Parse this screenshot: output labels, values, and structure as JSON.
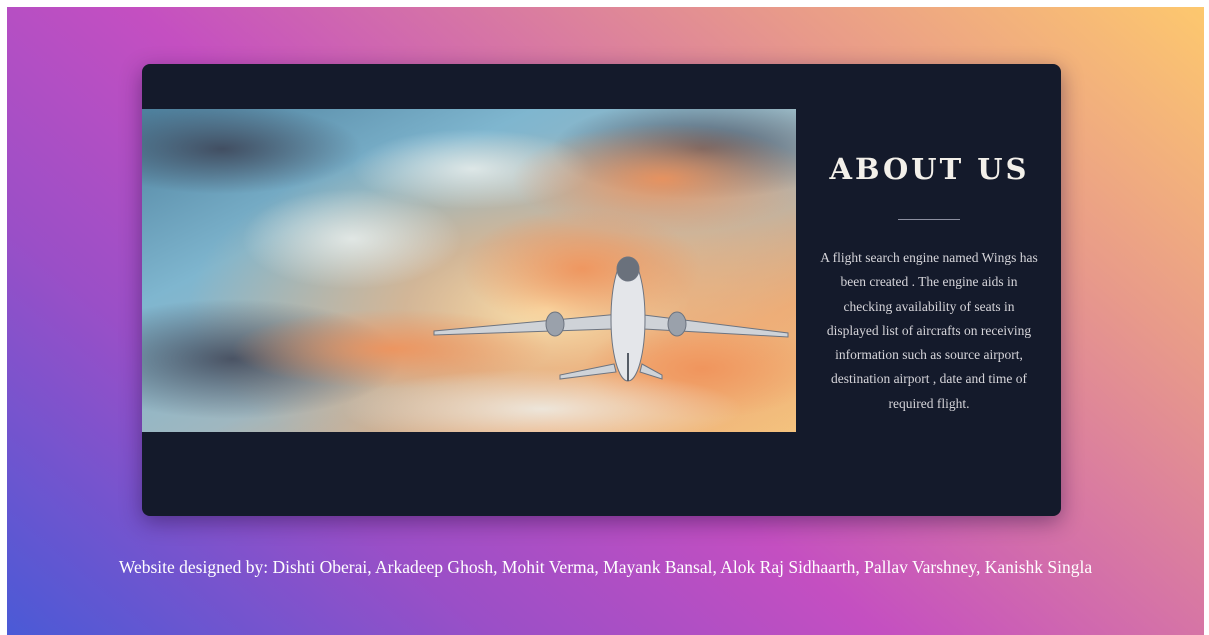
{
  "about": {
    "title": "ABOUT US",
    "description": "A flight search engine named Wings has been created . The engine aids in checking availability of seats in displayed list of aircrafts on receiving information such as source airport, destination airport , date and time of required flight."
  },
  "footer": {
    "credits": "Website designed by: Dishti Oberai, Arkadeep Ghosh, Mohit Verma, Mayank Bansal, Alok Raj Sidhaarth, Pallav Varshney, Kanishk Singla"
  },
  "colors": {
    "card_background": "#141a2b",
    "heading_text": "#f3f0ea",
    "gradient_start": "#fdc86e",
    "gradient_mid": "#c44fc1",
    "gradient_end": "#4a5ad6"
  },
  "image": {
    "subject": "airplane-flying-through-sunset-clouds"
  }
}
